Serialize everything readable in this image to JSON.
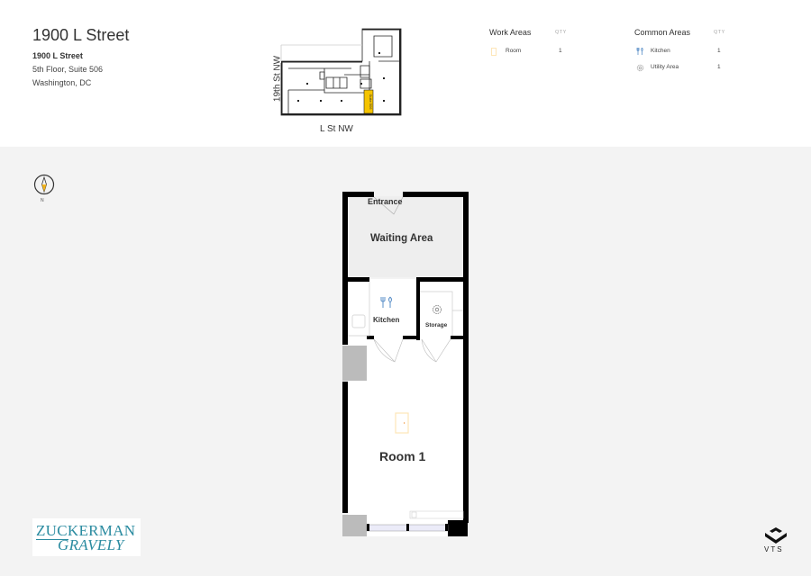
{
  "header": {
    "title": "1900 L Street",
    "building_name": "1900 L Street",
    "floor_suite": "5th Floor, Suite 506",
    "city": "Washington, DC"
  },
  "keyplan": {
    "side_street": "19th St NW",
    "bottom_street": "L St NW",
    "suite_tag": "Suite 506",
    "highlight_color": "#f5c400"
  },
  "legend": {
    "work_areas": {
      "heading": "Work Areas",
      "qty_header": "QTY",
      "items": [
        {
          "icon": "door-icon",
          "label": "Room",
          "qty": "1"
        }
      ]
    },
    "common_areas": {
      "heading": "Common Areas",
      "qty_header": "QTY",
      "items": [
        {
          "icon": "utensils-icon",
          "label": "Kitchen",
          "qty": "1"
        },
        {
          "icon": "gear-icon",
          "label": "Utility Area",
          "qty": "1"
        }
      ]
    }
  },
  "compass": {
    "label": "N"
  },
  "floorplan": {
    "rooms": {
      "entrance": "Entrance",
      "waiting": "Waiting Area",
      "kitchen": "Kitchen",
      "storage": "Storage",
      "room1": "Room 1"
    },
    "colors": {
      "wall": "#000000",
      "waiting_fill": "#eeeeee",
      "column_fill": "#bbbbbb",
      "work_icon": "#fde6b8",
      "common_icon": "#5a8fc8"
    }
  },
  "branding": {
    "broker_line1": "ZUCKERMAN",
    "broker_line2": "GRAVELY",
    "platform": "VTS"
  }
}
